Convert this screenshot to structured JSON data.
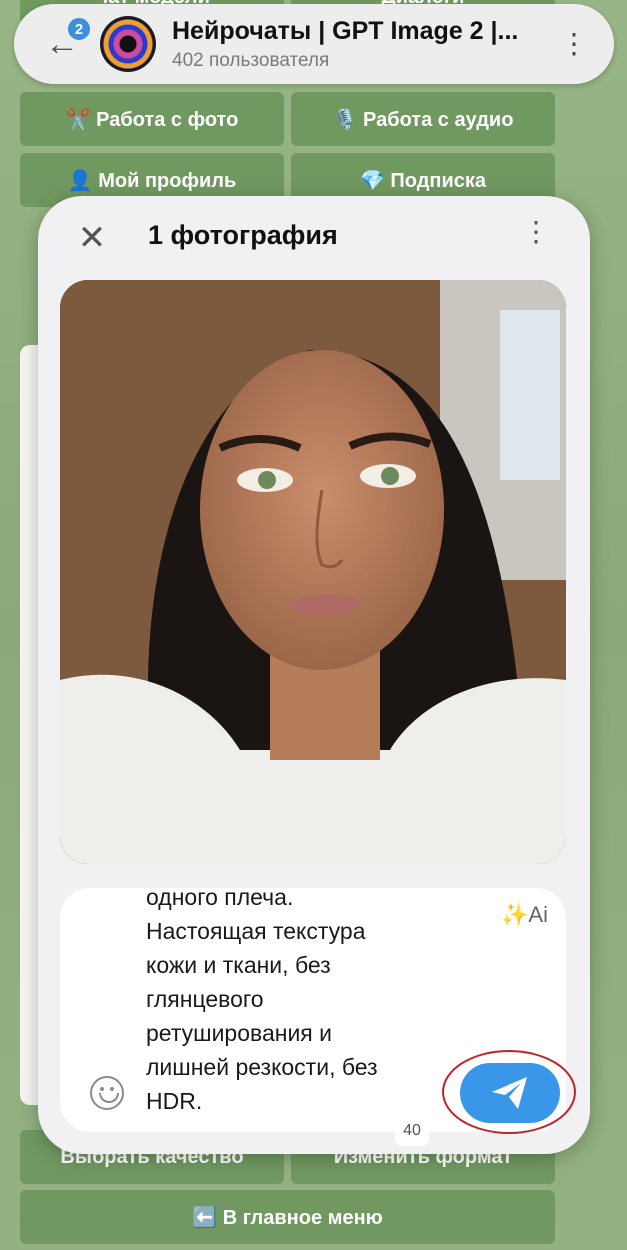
{
  "header": {
    "back_badge": "2",
    "title": "Нейрочаты | GPT Image 2 |...",
    "subtitle": "402 пользователя",
    "menu_icon": "⋮"
  },
  "keyboard": {
    "row0": [
      "Чат модели",
      "Диалоги"
    ],
    "row1": [
      "✂️ Работа с фото",
      "🎙️ Работа с аудио"
    ],
    "row2": [
      "👤 Мой профиль",
      "💎 Подписка"
    ],
    "row_bottom": [
      "Выбрать качество",
      "Изменить формат"
    ],
    "main_menu": "⬅️ В главное меню"
  },
  "modal": {
    "close_icon": "✕",
    "title": "1 фотография",
    "menu_icon": "⋮",
    "caption": "одного плеча.\nНастоящая текстура\nкожи и ткани, без\nглянцевого\nретуширования и\nлишней резкости, без\nHDR.",
    "ai_label": "✨Ai",
    "counter": "40"
  },
  "colors": {
    "send_button": "#3a96e8",
    "highlight_ring": "#c0242a",
    "badge": "#3d8fd9"
  }
}
